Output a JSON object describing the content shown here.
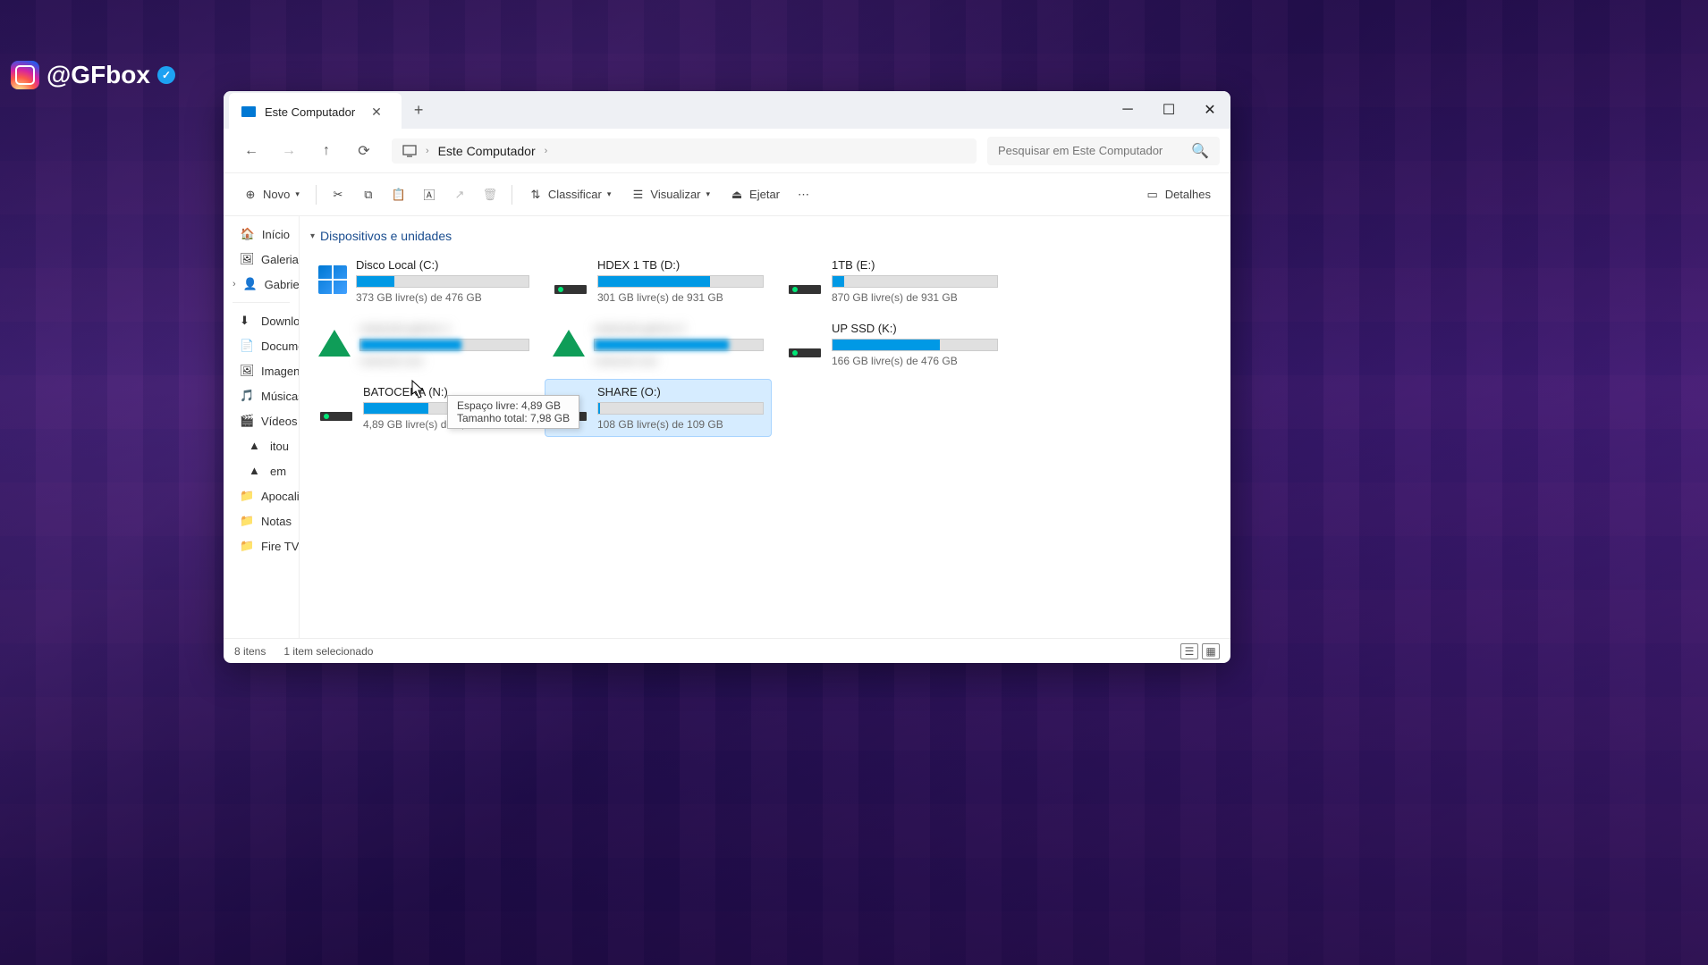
{
  "watermark": {
    "handle": "@GFbox"
  },
  "window": {
    "tab_title": "Este Computador",
    "breadcrumb": "Este Computador",
    "search_placeholder": "Pesquisar em Este Computador"
  },
  "toolbar": {
    "new": "Novo",
    "sort": "Classificar",
    "view": "Visualizar",
    "eject": "Ejetar",
    "details": "Detalhes"
  },
  "sidebar": {
    "items": [
      {
        "label": "Início",
        "icon": "home"
      },
      {
        "label": "Galeria",
        "icon": "gallery"
      },
      {
        "label": "Gabriel",
        "icon": "user",
        "expandable": true
      }
    ],
    "quick": [
      {
        "label": "Downloads",
        "icon": "download"
      },
      {
        "label": "Documentos",
        "icon": "doc"
      },
      {
        "label": "Imagens",
        "icon": "image"
      },
      {
        "label": "Músicas",
        "icon": "music"
      },
      {
        "label": "Vídeos",
        "icon": "video"
      },
      {
        "label": "itou",
        "icon": "gdrive"
      },
      {
        "label": "em",
        "icon": "gdrive"
      },
      {
        "label": "Apocalipse",
        "icon": "folder"
      },
      {
        "label": "Notas",
        "icon": "folder"
      },
      {
        "label": "Fire TV",
        "icon": "folder"
      }
    ]
  },
  "section": {
    "header": "Dispositivos e unidades"
  },
  "drives": [
    {
      "name": "Disco Local (C:)",
      "free": "373 GB livre(s) de 476 GB",
      "fill_pct": 22,
      "icon": "win",
      "blurred": false,
      "selected": false
    },
    {
      "name": "HDEX 1 TB (D:)",
      "free": "301 GB livre(s) de 931 GB",
      "fill_pct": 68,
      "icon": "hdd",
      "blurred": false,
      "selected": false
    },
    {
      "name": "1TB (E:)",
      "free": "870 GB livre(s) de 931 GB",
      "fill_pct": 7,
      "icon": "hdd",
      "blurred": false,
      "selected": false
    },
    {
      "name": "redacted-gdrive-1",
      "free": "redacted size",
      "fill_pct": 60,
      "icon": "gdrive",
      "blurred": true,
      "selected": false
    },
    {
      "name": "redacted-gdrive-2",
      "free": "redacted size",
      "fill_pct": 80,
      "icon": "gdrive",
      "blurred": true,
      "selected": false
    },
    {
      "name": "UP SSD (K:)",
      "free": "166 GB livre(s) de 476 GB",
      "fill_pct": 65,
      "icon": "hdd",
      "blurred": false,
      "selected": false
    },
    {
      "name": "BATOCERA (N:)",
      "free": "4,89 GB livre(s) de 7,98 GB",
      "fill_pct": 39,
      "icon": "hdd",
      "blurred": false,
      "selected": false
    },
    {
      "name": "SHARE (O:)",
      "free": "108 GB livre(s) de 109 GB",
      "fill_pct": 1,
      "icon": "hdd",
      "blurred": false,
      "selected": true
    }
  ],
  "tooltip": {
    "line1": "Espaço livre: 4,89 GB",
    "line2": "Tamanho total: 7,98 GB"
  },
  "statusbar": {
    "count": "8 itens",
    "selected": "1 item selecionado"
  }
}
